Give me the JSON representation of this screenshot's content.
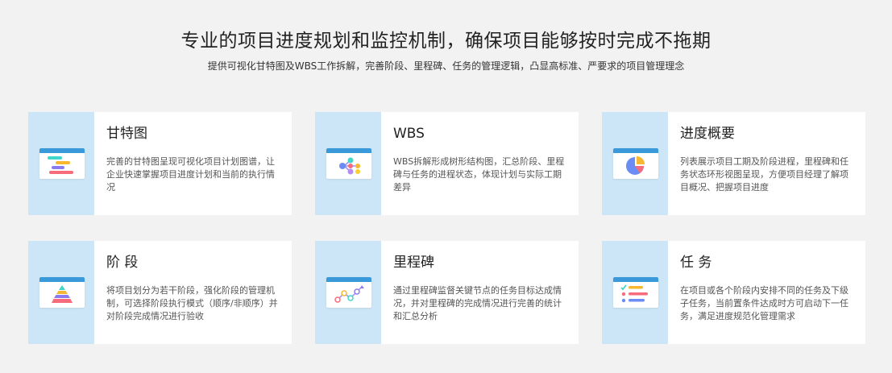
{
  "header": {
    "title": "专业的项目进度规划和监控机制，确保项目能够按时完成不拖期",
    "subtitle": "提供可视化甘特图及WBS工作拆解，完善阶段、里程碑、任务的管理逻辑，凸显高标准、严要求的项目管理理念"
  },
  "cards": [
    {
      "icon": "gantt-chart-icon",
      "title": "甘特图",
      "desc": "完善的甘特图呈现可视化项目计划图谱，让企业快速掌握项目进度计划和当前的执行情况"
    },
    {
      "icon": "wbs-tree-icon",
      "title": "WBS",
      "desc": "WBS拆解形成树形结构图，汇总阶段、里程碑与任务的进程状态，体现计划与实际工期差异"
    },
    {
      "icon": "pie-chart-icon",
      "title": "进度概要",
      "desc": "列表展示项目工期及阶段进程，里程碑和任务状态环形视图呈现，方便项目经理了解项目概况、把握项目进度"
    },
    {
      "icon": "pyramid-icon",
      "title": "阶 段",
      "desc": "将项目划分为若干阶段，强化阶段的管理机制，可选择阶段执行模式（顺序/非顺序）并对阶段完成情况进行验收"
    },
    {
      "icon": "milestone-line-icon",
      "title": "里程碑",
      "desc": "通过里程碑监督关键节点的任务目标达成情况，并对里程碑的完成情况进行完善的统计和汇总分析"
    },
    {
      "icon": "task-list-icon",
      "title": "任 务",
      "desc": "在项目或各个阶段内安排不同的任务及下级子任务，当前置条件达成时方可启动下一任务，满足进度规范化管理需求"
    }
  ],
  "colors": {
    "background": "#f2f2f2",
    "card": "#ffffff",
    "icon_panel": "#cce6f7",
    "accent": "#3a9ad9"
  }
}
